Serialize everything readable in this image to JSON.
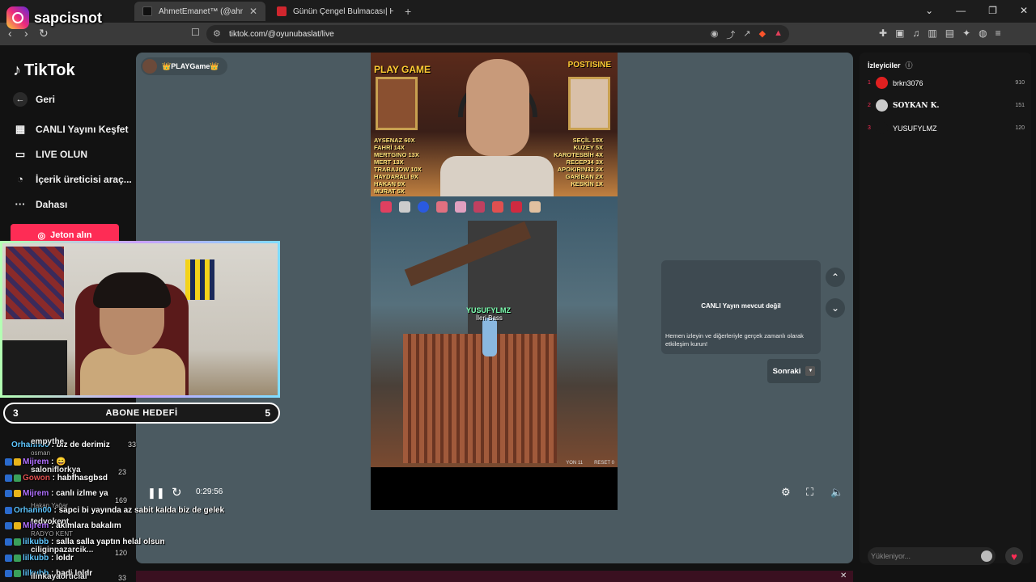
{
  "browser": {
    "tabs": [
      {
        "title": "AhmetEmanet™ (@ahmtemna",
        "active": true
      },
      {
        "title": "Günün Çengel Bulmacası| HT Bulmac",
        "active": false
      }
    ],
    "new_tab": "+",
    "url": "tiktok.com/@oyunubaslat/live",
    "window_controls": [
      "⌄",
      "—",
      "❐",
      "✕"
    ]
  },
  "instagram_overlay": {
    "handle": "sapcisnot"
  },
  "sidebar": {
    "brand": "TikTok",
    "items": [
      {
        "label": "Geri",
        "icon": "back-arrow-icon"
      },
      {
        "label": "CANLI Yayını Keşfet",
        "icon": "live-tv-icon"
      },
      {
        "label": "LIVE OLUN",
        "icon": "camera-icon"
      },
      {
        "label": "İçerik üreticisi araç...",
        "icon": "lightbulb-icon"
      },
      {
        "label": "Dahası",
        "icon": "more-dots-icon"
      }
    ],
    "coin_button": "Jeton alın"
  },
  "stream": {
    "host_name": "👑PLAYGame👑",
    "game_title_left": "PLAY GAME",
    "game_title_right": "POSTISINE",
    "leaderboard_left": "AYSENAZ 60X\nFAHRİ 14X\nMERTGINO 13X\nMERT 13X\nTRABAJOW 10X\nHAYDARALİ 9X\nHAKAN 9X\nMURAT 5X\nWOLFMANUS 4X",
    "leaderboard_right": "SEÇİL 15X\nKUZEY 5X\nKAROTESBİH 4X\nRECEP34 3X\nAPOKIRIN33 2X\nGARİBAN 2X\nKESKİN 1X",
    "player_tag": "YUSUFYLMZ",
    "player_sub": "İleri Bass",
    "score_labels": [
      "YON 11",
      "RESET 0"
    ],
    "elapsed": "0:29:56",
    "offline_title": "CANLI Yayın mevcut değil",
    "offline_desc": "Hemen izleyin ve diğerleriyle gerçek zamanlı olarak etkileşim kurun!",
    "next_label": "Sonraki"
  },
  "viewers": {
    "header": "İzleyiciler",
    "rows": [
      {
        "rank": "1",
        "name": "brkn3076",
        "count": "910",
        "color": "#e02020"
      },
      {
        "rank": "2",
        "name": "SOYKAN K.",
        "count": "151",
        "color": "#cccccc"
      },
      {
        "rank": "3",
        "name": "YUSUFYLMZ",
        "count": "120",
        "color": "#161616"
      }
    ],
    "loading_placeholder": "Yükleniyor..."
  },
  "overlay": {
    "goal_start": "3",
    "goal_label": "ABONE HEDEFİ",
    "goal_end": "5"
  },
  "chat": [
    {
      "user": "Orhann00",
      "msg": " : biz de derimiz",
      "count": "33"
    },
    {
      "user": "empythe",
      "msg": "",
      "count": ""
    },
    {
      "user": "osman",
      "msg": "",
      "count": ""
    },
    {
      "user": "Mijrem",
      "msg": " : 😄",
      "count": ""
    },
    {
      "user": "saloniflorkya",
      "msg": "",
      "count": "23"
    },
    {
      "user": "Gowon",
      "msg": " : habfhasgbsd",
      "count": ""
    },
    {
      "user": "Mijrem",
      "msg": " : canlı izlme ya",
      "count": ""
    },
    {
      "user": "Hakan Yağar",
      "msg": "",
      "count": "169"
    },
    {
      "user": "Orhann00",
      "msg": " : sapci bi yayında az sabit kalda biz de gelek",
      "count": ""
    },
    {
      "user": "tedvokent",
      "msg": "",
      "count": ""
    },
    {
      "user": "Mijrem",
      "msg": " : akımlara bakalım",
      "count": ""
    },
    {
      "user": "RADYO KENT",
      "msg": "",
      "count": ""
    },
    {
      "user": "lilkubb",
      "msg": " : salla salla yaptın helal olsun",
      "count": ""
    },
    {
      "user": "ciliginpazarcik...",
      "msg": "",
      "count": "120"
    },
    {
      "user": "lilkubb",
      "msg": " : loldr",
      "count": ""
    },
    {
      "user": "lilkubb",
      "msg": " : hadi loldr",
      "count": ""
    },
    {
      "user": "ilinkayaorticial",
      "msg": "",
      "count": "33"
    }
  ]
}
